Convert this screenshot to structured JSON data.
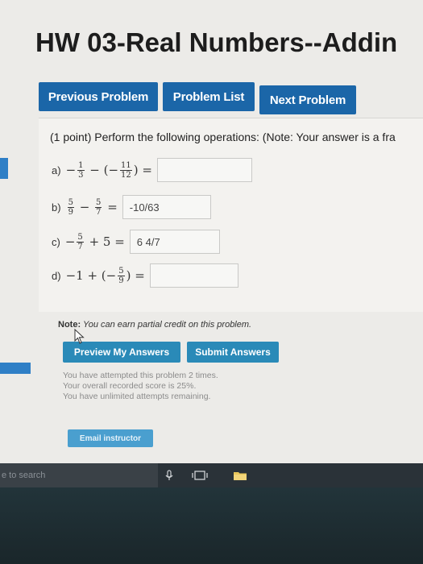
{
  "page": {
    "title": "HW 03-Real Numbers--Addin"
  },
  "nav": {
    "previous": "Previous Problem",
    "list": "Problem List",
    "next": "Next Problem"
  },
  "problem": {
    "intro": "(1 point) Perform the following operations: (Note: Your answer is a fra",
    "questions": [
      {
        "label": "a)",
        "answer": ""
      },
      {
        "label": "b)",
        "answer": "-10/63"
      },
      {
        "label": "c)",
        "answer": "6 4/7"
      },
      {
        "label": "d)",
        "answer": ""
      }
    ]
  },
  "note": {
    "prefix": "Note:",
    "text": "You can earn partial credit on this problem."
  },
  "actions": {
    "preview": "Preview My Answers",
    "submit": "Submit Answers"
  },
  "status": {
    "line1": "You have attempted this problem 2 times.",
    "line2": "Your overall recorded score is 25%.",
    "line3": "You have unlimited attempts remaining."
  },
  "email": "Email instructor",
  "taskbar": {
    "search": "e to search",
    "icons": [
      "microphone-icon",
      "task-view-icon",
      "file-explorer-icon"
    ]
  },
  "colors": {
    "nav_button": "#1b66a8",
    "action_button": "#2a8ab8",
    "sidebar_accent": "#2f7fc6"
  }
}
